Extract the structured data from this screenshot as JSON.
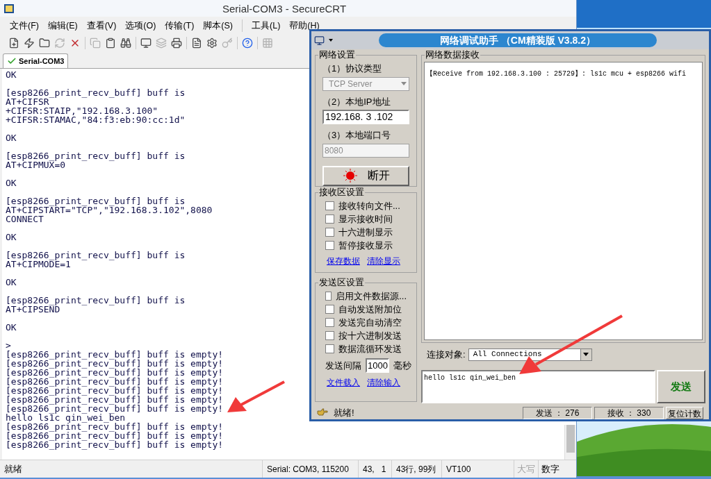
{
  "secure_crt": {
    "title": "Serial-COM3 - SecureCRT",
    "menu": [
      "文件(F)",
      "编辑(E)",
      "查看(V)",
      "选项(O)",
      "传输(T)",
      "脚本(S)",
      "工具(L)",
      "帮助(H)"
    ],
    "toolbar": [
      {
        "disabled": false
      },
      {
        "disabled": false
      },
      {
        "disabled": false
      },
      {
        "disabled": true
      },
      {
        "disabled": false
      },
      {
        "disabled": true
      },
      {
        "disabled": false
      },
      {
        "disabled": false
      },
      {
        "disabled": false
      },
      {
        "disabled": true
      },
      {
        "disabled": false
      },
      {
        "disabled": false
      },
      {
        "disabled": false
      },
      {
        "disabled": true
      },
      {
        "disabled": false
      },
      {
        "disabled": true
      }
    ],
    "tab": {
      "label": "Serial-COM3",
      "connected": true,
      "selected": true
    },
    "terminal_blocks": [
      [
        "OK"
      ],
      [
        "[esp8266_print_recv_buff] buff is",
        "AT+CIFSR",
        "+CIFSR:STAIP,\"192.168.3.100\"",
        "+CIFSR:STAMAC,\"84:f3:eb:90:cc:1d\""
      ],
      [
        "OK"
      ],
      [
        "[esp8266_print_recv_buff] buff is",
        "AT+CIPMUX=0"
      ],
      [
        "OK"
      ],
      [
        "[esp8266_print_recv_buff] buff is",
        "AT+CIPSTART=\"TCP\",\"192.168.3.102\",8080",
        "CONNECT"
      ],
      [
        "OK"
      ],
      [
        "[esp8266_print_recv_buff] buff is",
        "AT+CIPMODE=1"
      ],
      [
        "OK"
      ],
      [
        "[esp8266_print_recv_buff] buff is",
        "AT+CIPSEND"
      ],
      [
        "OK"
      ],
      [
        ">",
        "[esp8266_print_recv_buff] buff is empty!",
        "[esp8266_print_recv_buff] buff is empty!",
        "[esp8266_print_recv_buff] buff is empty!",
        "[esp8266_print_recv_buff] buff is empty!",
        "[esp8266_print_recv_buff] buff is empty!",
        "[esp8266_print_recv_buff] buff is empty!",
        "[esp8266_print_recv_buff] buff is empty!",
        "hello ls1c qin_wei_ben",
        "[esp8266_print_recv_buff] buff is empty!",
        "[esp8266_print_recv_buff] buff is empty!",
        "[esp8266_print_recv_buff] buff is empty!"
      ]
    ],
    "status_bar": {
      "message": "就绪",
      "cells": [
        "Serial: COM3, 115200",
        "43,   1",
        "43行, 99列",
        "VT100"
      ],
      "indicators": [
        {
          "label": "大写",
          "on": false
        },
        {
          "label": "数字",
          "on": true
        }
      ]
    }
  },
  "net_assistant": {
    "title": "网络调试助手 （CM精装版 V3.8.2）",
    "network_settings": {
      "legend": "网络设置",
      "protocol_label": "（1）协议类型",
      "protocol": {
        "value": "TCP Server",
        "disabled": true
      },
      "ip_label": "（2）本地IP地址",
      "ip": "192.168. 3 .102",
      "port_label": "（3）本地端口号",
      "port": {
        "value": "8080",
        "disabled": true
      },
      "button": {
        "label": "断开",
        "connected": true
      }
    },
    "receive_settings": {
      "legend": "接收区设置",
      "options": [
        {
          "label": "接收转向文件...",
          "checked": false
        },
        {
          "label": "显示接收时间",
          "checked": false
        },
        {
          "label": "十六进制显示",
          "checked": false
        },
        {
          "label": "暂停接收显示",
          "checked": false
        }
      ],
      "links": [
        "保存数据",
        "清除显示"
      ]
    },
    "send_settings": {
      "legend": "发送区设置",
      "options": [
        {
          "label": "启用文件数据源...",
          "checked": false
        },
        {
          "label": "自动发送附加位",
          "checked": false
        },
        {
          "label": "发送完自动清空",
          "checked": false
        },
        {
          "label": "按十六进制发送",
          "checked": false
        },
        {
          "label": "数据流循环发送",
          "checked": false
        }
      ],
      "interval_label": "发送间隔",
      "interval": "1000",
      "interval_unit": "毫秒",
      "links": [
        "文件载入",
        "清除输入"
      ]
    },
    "receive_panel": {
      "legend": "网络数据接收",
      "text": "【Receive from 192.168.3.100 : 25729】: ls1c mcu + esp8266 wifi"
    },
    "connection": {
      "label": "连接对象:",
      "value": "All Connections"
    },
    "send_input": "hello ls1c qin_wei_ben",
    "send_button": "发送",
    "status_bar": {
      "message": "就绪!",
      "sent": "发送 ： 276",
      "received": "接收 ： 330",
      "reset_button": "复位计数"
    }
  }
}
